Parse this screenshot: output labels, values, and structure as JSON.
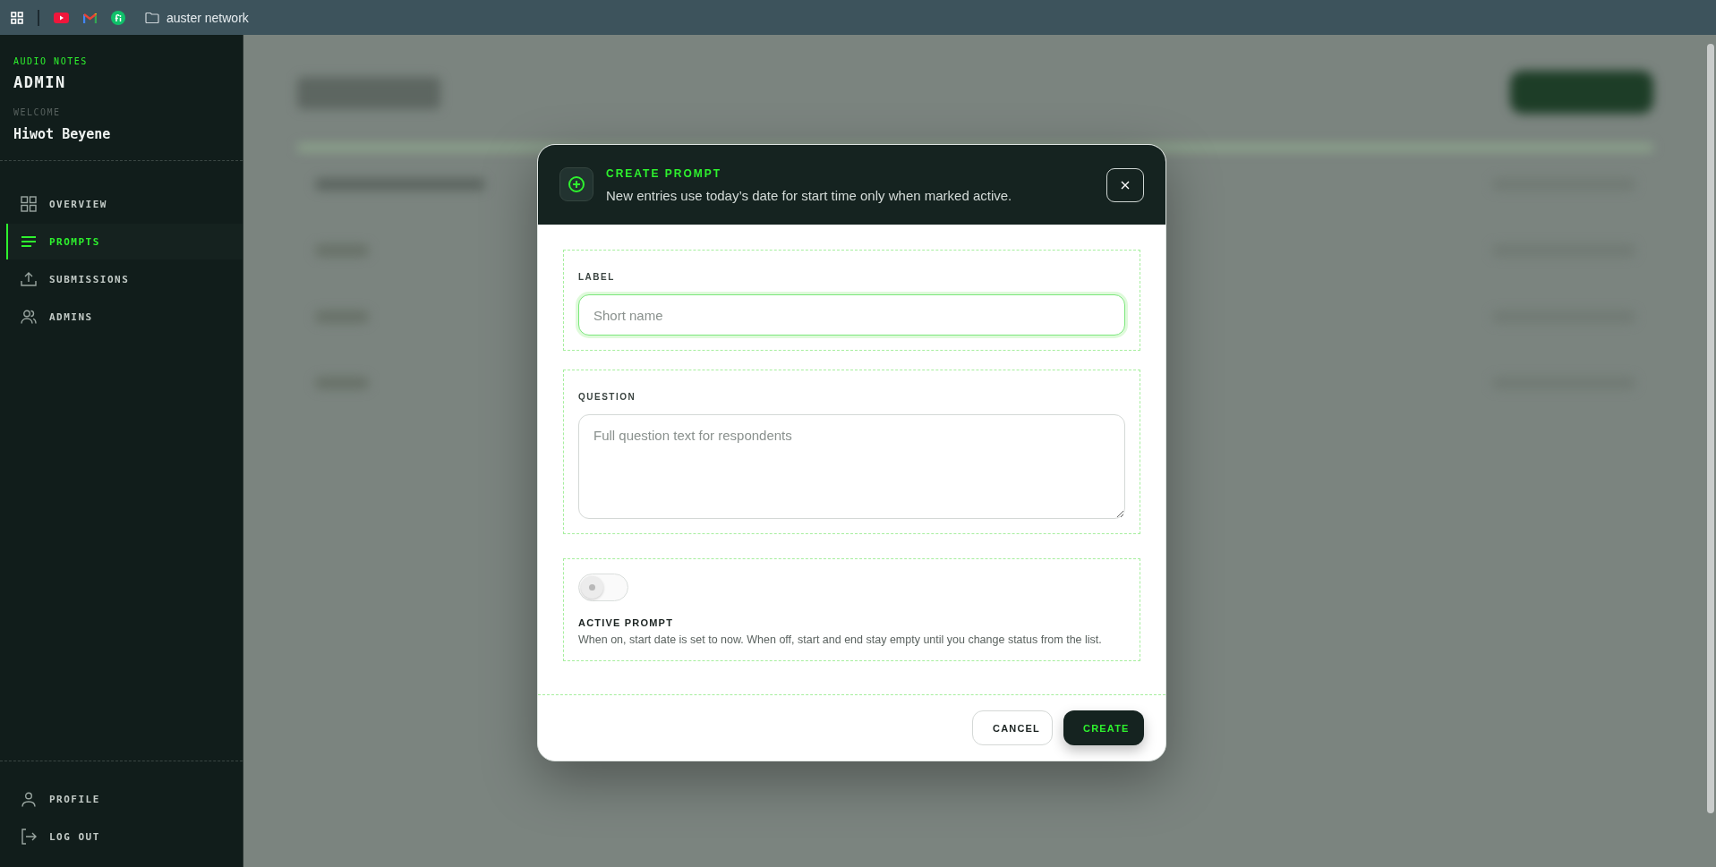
{
  "browser_bar": {
    "bookmarks": [
      {
        "kind": "apps"
      },
      {
        "kind": "separator"
      },
      {
        "kind": "youtube"
      },
      {
        "kind": "gmail"
      },
      {
        "kind": "fi"
      },
      {
        "kind": "folder",
        "label": "auster network"
      }
    ]
  },
  "sidebar": {
    "brand": "AUDIO NOTES",
    "title": "ADMIN",
    "welcome_label": "WELCOME",
    "user_name": "Hiwot Beyene",
    "nav": [
      {
        "label": "OVERVIEW",
        "kind": "grid",
        "selected": false
      },
      {
        "label": "PROMPTS",
        "kind": "lines",
        "selected": true
      },
      {
        "label": "SUBMISSIONS",
        "kind": "upload",
        "selected": false
      },
      {
        "label": "ADMINS",
        "kind": "users",
        "selected": false
      }
    ],
    "footer": [
      {
        "label": "PROFILE",
        "kind": "user"
      },
      {
        "label": "LOG OUT",
        "kind": "logout"
      }
    ]
  },
  "modal": {
    "title": "CREATE PROMPT",
    "subtitle": "New entries use today’s date for start time only when marked active.",
    "fields": [
      {
        "kind": "input",
        "label": "LABEL",
        "placeholder": "Short name",
        "focused": true
      },
      {
        "kind": "textarea",
        "label": "QUESTION",
        "placeholder": "Full question text for respondents",
        "focused": false
      }
    ],
    "toggle": {
      "label": "ACTIVE PROMPT",
      "description": "When on, start date is set to now. When off, start and end stay empty until you change status from the list.",
      "on": false
    },
    "buttons": [
      {
        "kind": "secondary",
        "label": "CANCEL"
      },
      {
        "kind": "primary",
        "label": "CREATE"
      }
    ]
  }
}
